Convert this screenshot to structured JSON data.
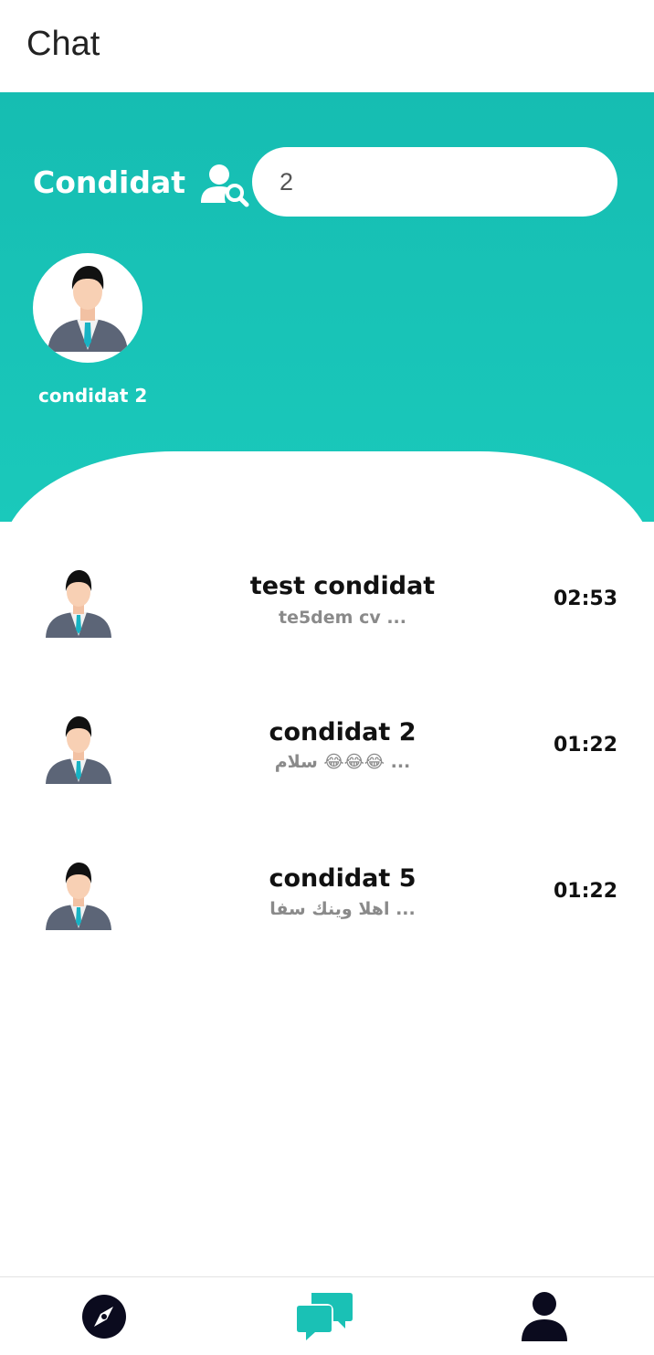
{
  "appbar": {
    "title": "Chat"
  },
  "header": {
    "section_title": "Condidat",
    "search": {
      "value": "2",
      "placeholder": ""
    }
  },
  "online_users": [
    {
      "name": "condidat 2"
    }
  ],
  "conversations": [
    {
      "name": "test condidat",
      "last_message": "te5dem cv  ...",
      "time": "02:53"
    },
    {
      "name": "condidat 2",
      "last_message": "سلام 😂😂😂 ...",
      "time": "01:22"
    },
    {
      "name": "condidat 5",
      "last_message": "اهلا وينك سفا ...",
      "time": "01:22"
    }
  ],
  "bottom_nav": [
    {
      "icon": "compass-icon",
      "active": false
    },
    {
      "icon": "chat-bubbles-icon",
      "active": true
    },
    {
      "icon": "profile-icon",
      "active": false
    }
  ],
  "colors": {
    "accent": "#1ac1b5",
    "nav_dark": "#0b0b1e"
  }
}
